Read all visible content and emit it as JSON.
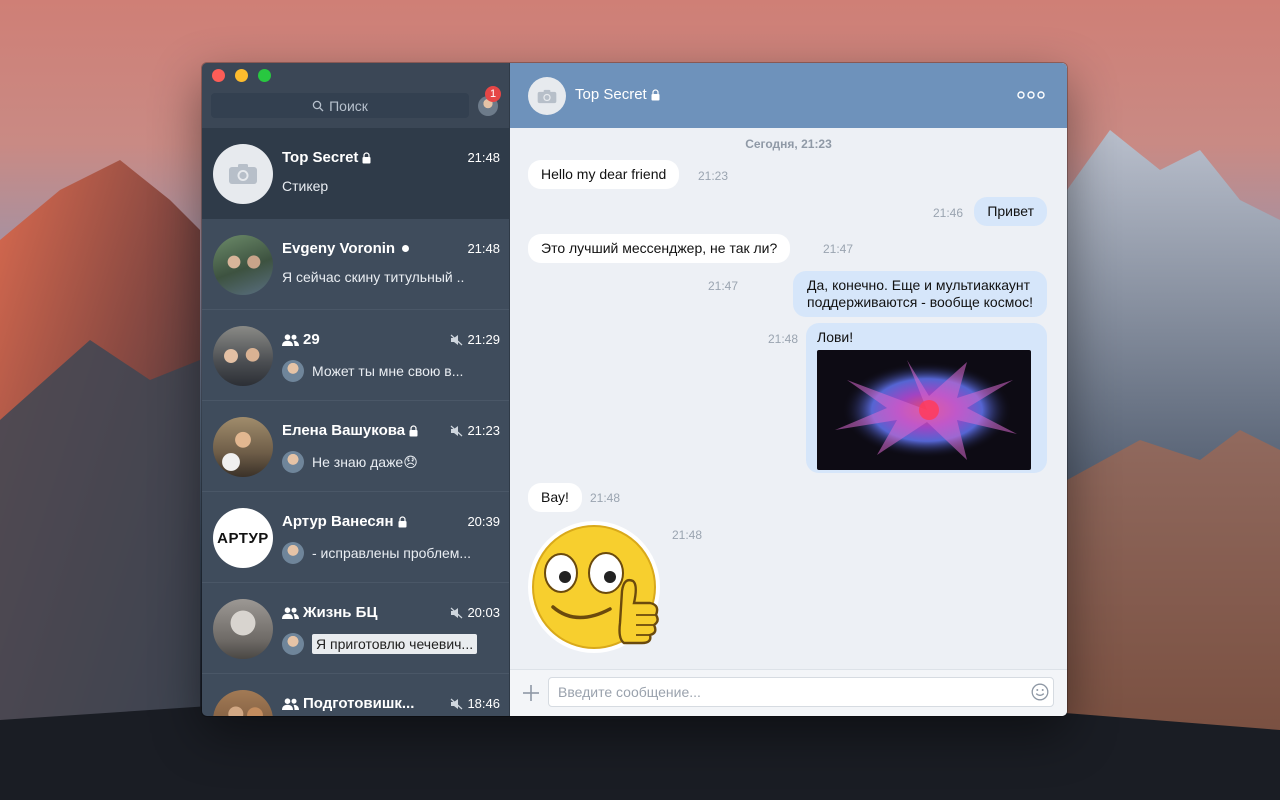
{
  "sidebar": {
    "search_placeholder": "Поиск",
    "badge_count": "1",
    "chats": [
      {
        "name": "Top Secret",
        "time": "21:48",
        "preview": "Стикер"
      },
      {
        "name": "Evgeny Voronin",
        "time": "21:48",
        "preview": "Я сейчас скину титульный .."
      },
      {
        "name": "29",
        "time": "21:29",
        "preview": "Может ты мне свою в..."
      },
      {
        "name": "Елена Вашукова",
        "time": "21:23",
        "preview": "Не знаю даже😞"
      },
      {
        "name": "Артур Ванесян",
        "time": "20:39",
        "preview": "- исправлены проблем...",
        "avatar_text": "АРТУР"
      },
      {
        "name": "Жизнь БЦ",
        "time": "20:03",
        "preview": "Я приготовлю чечевич..."
      },
      {
        "name": "Подготовишк...",
        "time": "18:46",
        "preview": ""
      }
    ]
  },
  "header": {
    "title": "Top Secret"
  },
  "conversation": {
    "date_separator": "Сегодня, 21:23",
    "messages": [
      {
        "text": "Hello my dear friend",
        "time": "21:23",
        "dir": "in"
      },
      {
        "text": "Привет",
        "time": "21:46",
        "dir": "out"
      },
      {
        "text": "Это лучший мессенджер, не так ли?",
        "time": "21:47",
        "dir": "in"
      },
      {
        "text_line1": "Да, конечно. Еще и мультиаккаунт",
        "text_line2": "поддерживаются - вообще космос!",
        "time": "21:47",
        "dir": "out"
      },
      {
        "text": "Лови!",
        "time": "21:48",
        "dir": "out"
      },
      {
        "text": "Вау!",
        "time": "21:48",
        "dir": "in"
      },
      {
        "time": "21:48",
        "dir": "in",
        "kind": "sticker"
      }
    ]
  },
  "composer": {
    "placeholder": "Введите сообщение..."
  },
  "colors": {
    "header": "#6e92bb",
    "sidebar": "#3f4c5c",
    "out_bubble": "#d6e6fa",
    "badge": "#e64646"
  }
}
